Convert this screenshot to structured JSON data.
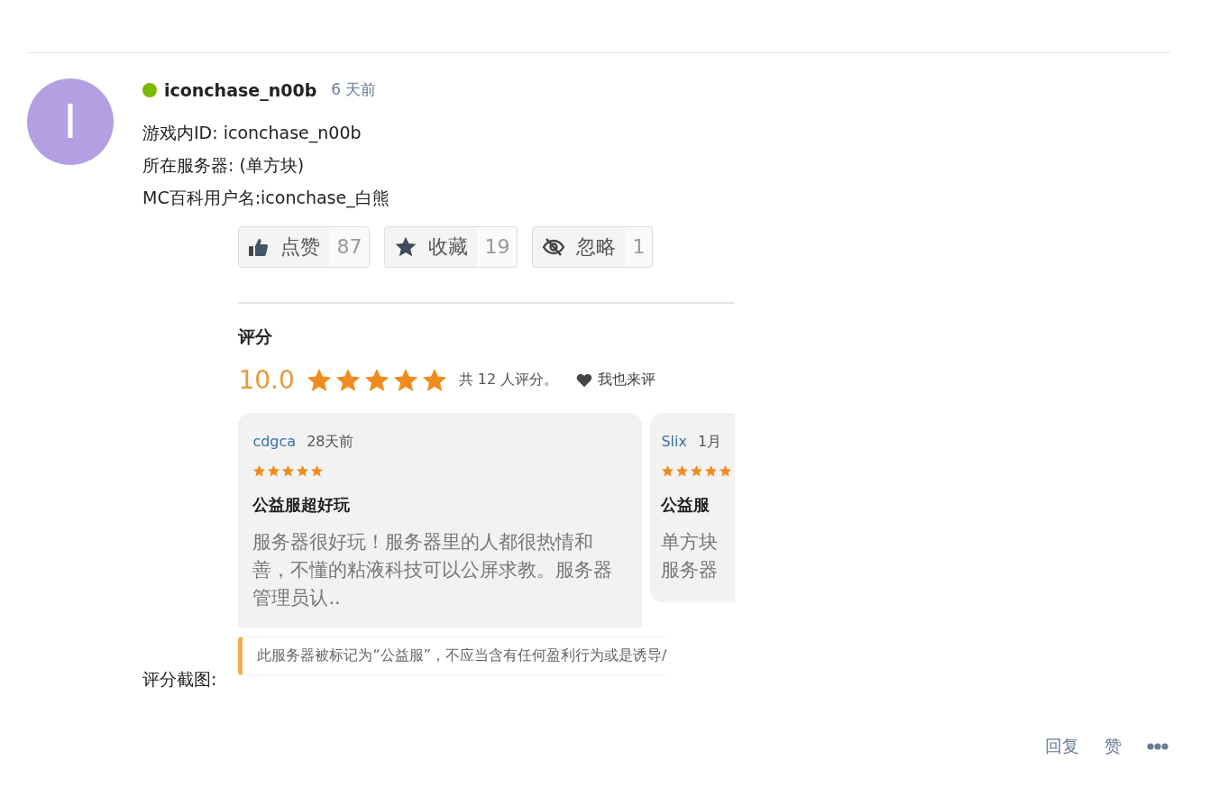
{
  "post": {
    "author": "iconchase_n00b",
    "online": true,
    "avatar_letter": "I",
    "time": "6 天前",
    "lines": [
      "游戏内ID: iconchase_n00b",
      "所在服务器: (单方块)",
      "MC百科用户名:iconchase_白熊"
    ],
    "screenshot_label": "评分截图:",
    "screenshot": {
      "buttons": [
        {
          "kind": "like",
          "label": "点赞",
          "count": "87"
        },
        {
          "kind": "favorite",
          "label": "收藏",
          "count": "19"
        },
        {
          "kind": "ignore",
          "label": "忽略",
          "count": "1"
        }
      ],
      "heading": "评分",
      "score": "10.0",
      "stars": 5,
      "count_text": "共 12 人评分。",
      "rate_link": "我也来评",
      "reviews": [
        {
          "user": "cdgca",
          "time": "28天前",
          "stars": 5,
          "title": "公益服超好玩",
          "body": "服务器很好玩！服务器里的人都很热情和善，不懂的粘液科技可以公屏求教。服务器管理员认.."
        },
        {
          "user": "Slix",
          "time": "1月",
          "stars": 5,
          "title": "公益服",
          "body_lines": [
            "单方块",
            "服务器"
          ]
        }
      ],
      "notice": "此服务器被标记为“公益服”，不应当含有任何盈利行为或是诱导/"
    },
    "actions": [
      "回复",
      "赞"
    ]
  }
}
